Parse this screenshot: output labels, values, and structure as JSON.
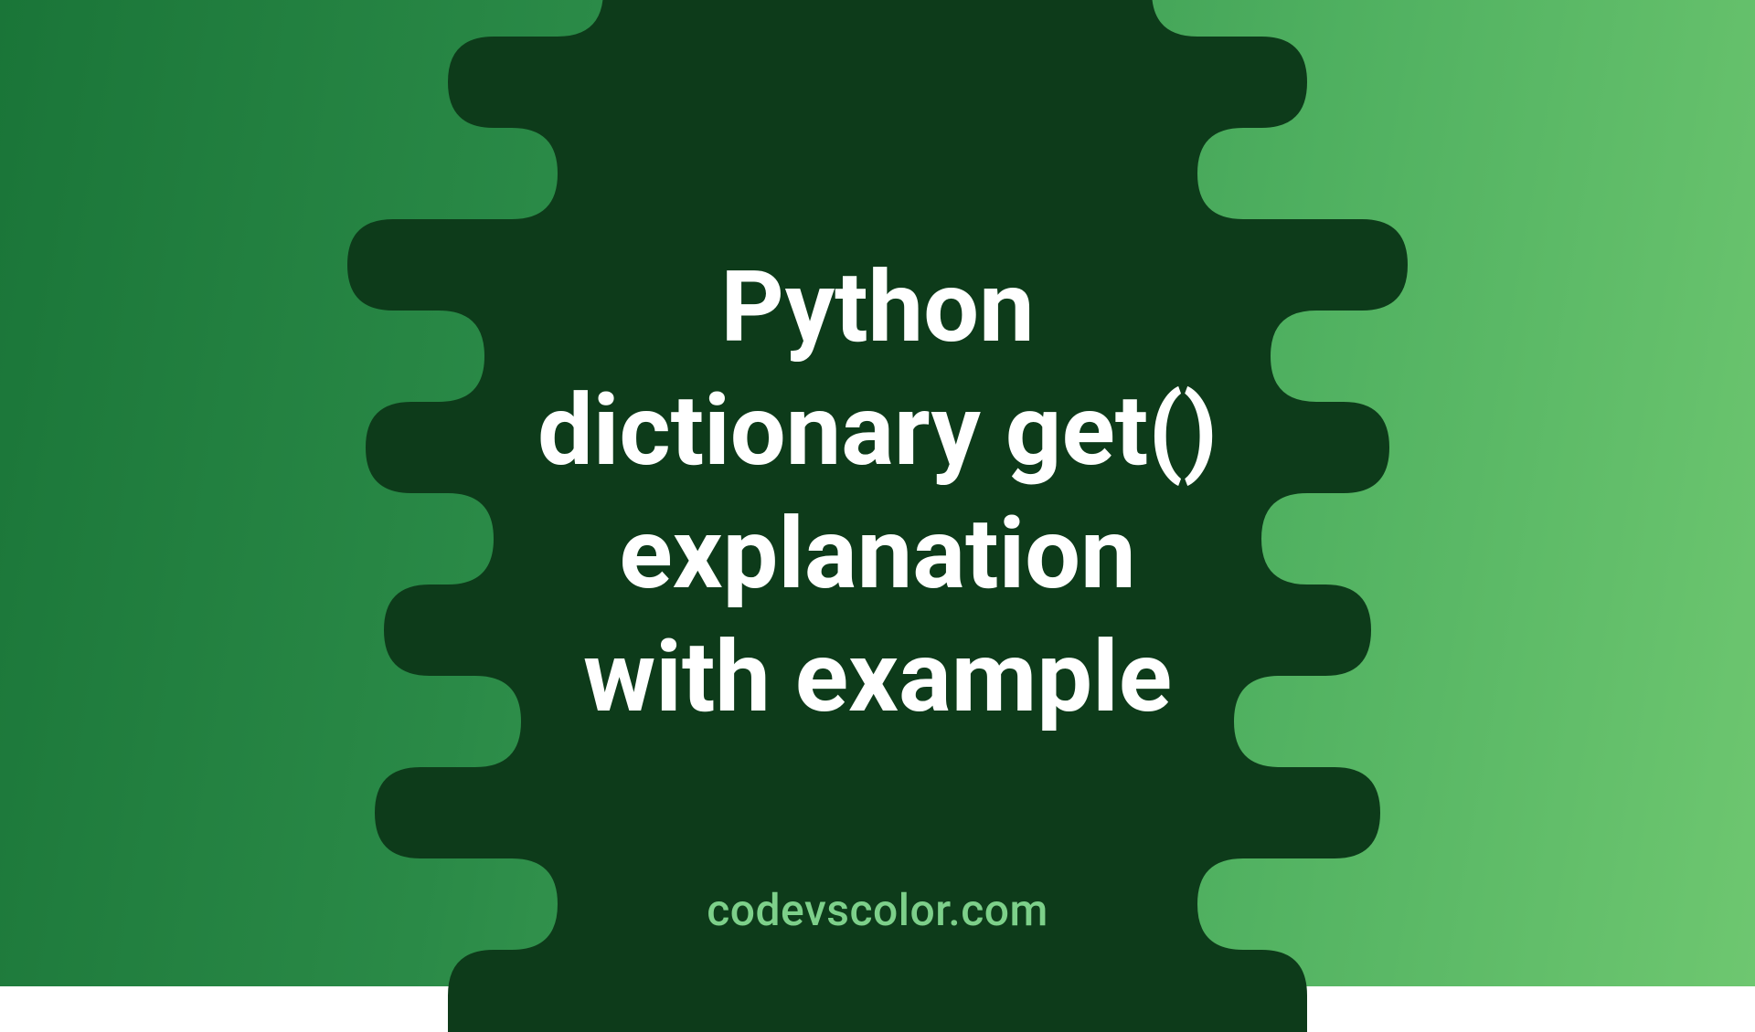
{
  "title_lines": [
    "Python",
    "dictionary get()",
    "explanation",
    "with example"
  ],
  "footer": "codevscolor.com",
  "colors": {
    "bg_gradient_start": "#1a7538",
    "bg_gradient_end": "#6ec770",
    "blob_fill": "#0d3b1a",
    "title_text": "#ffffff",
    "footer_text": "#7dd08a"
  }
}
